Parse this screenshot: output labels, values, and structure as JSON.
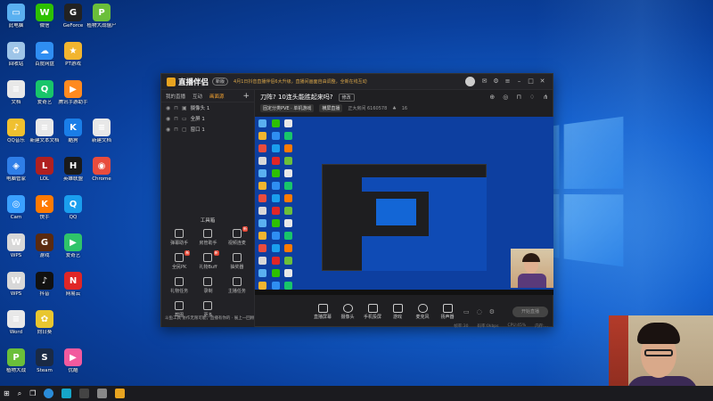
{
  "desktop": {
    "icons": [
      {
        "label": "此电脑",
        "color": "#5ab0f0",
        "glyph": "▭"
      },
      {
        "label": "微信",
        "color": "#2dc100",
        "glyph": "W"
      },
      {
        "label": "GeForce",
        "color": "#222",
        "glyph": "G"
      },
      {
        "label": "植物大战僵尸",
        "color": "#6bbf3a",
        "glyph": "P"
      },
      {
        "label": "回收站",
        "color": "#9ec5e8",
        "glyph": "♻"
      },
      {
        "label": "百度网盘",
        "color": "#2f8ef2",
        "glyph": "☁"
      },
      {
        "label": "PT游戏",
        "color": "#f2b52f",
        "glyph": "★"
      },
      {
        "label": "",
        "color": "",
        "glyph": ""
      },
      {
        "label": "文档",
        "color": "#e8e8e8",
        "glyph": "≡"
      },
      {
        "label": "爱奇艺",
        "color": "#18c56a",
        "glyph": "Q"
      },
      {
        "label": "腾讯手游助手",
        "color": "#ff8a1f",
        "glyph": "▶"
      },
      {
        "label": "",
        "color": "",
        "glyph": ""
      },
      {
        "label": "QQ音乐",
        "color": "#f0c02f",
        "glyph": "♪"
      },
      {
        "label": "新建文本文档",
        "color": "#e8e8e8",
        "glyph": "≡"
      },
      {
        "label": "酷狗",
        "color": "#1a7ee8",
        "glyph": "K"
      },
      {
        "label": "新建文档",
        "color": "#e8e8e8",
        "glyph": "≡"
      },
      {
        "label": "电脑管家",
        "color": "#2f7ee8",
        "glyph": "◈"
      },
      {
        "label": "LOL",
        "color": "#b02020",
        "glyph": "L"
      },
      {
        "label": "英雄联盟",
        "color": "#1a1a1a",
        "glyph": "H"
      },
      {
        "label": "Chrome",
        "color": "#e84c3d",
        "glyph": "◉"
      },
      {
        "label": "Cam",
        "color": "#3aa0ff",
        "glyph": "◎"
      },
      {
        "label": "快手",
        "color": "#ff7a00",
        "glyph": "K"
      },
      {
        "label": "QQ",
        "color": "#1a9eee",
        "glyph": "Q"
      },
      {
        "label": "",
        "color": "",
        "glyph": ""
      },
      {
        "label": "WPS",
        "color": "#d8d8d8",
        "glyph": "W"
      },
      {
        "label": "游戏",
        "color": "#5a2a10",
        "glyph": "G"
      },
      {
        "label": "爱奇艺",
        "color": "#2fc46a",
        "glyph": "▶"
      },
      {
        "label": "",
        "color": "",
        "glyph": ""
      },
      {
        "label": "WPS",
        "color": "#d8d8d8",
        "glyph": "W"
      },
      {
        "label": "抖音",
        "color": "#111",
        "glyph": "♪"
      },
      {
        "label": "网易云",
        "color": "#e02626",
        "glyph": "N"
      },
      {
        "label": "",
        "color": "",
        "glyph": ""
      },
      {
        "label": "Word",
        "color": "#e8e8e8",
        "glyph": "≡"
      },
      {
        "label": "向日葵",
        "color": "#e8c62f",
        "glyph": "✿"
      },
      {
        "label": "",
        "color": "",
        "glyph": ""
      },
      {
        "label": "",
        "color": "",
        "glyph": ""
      },
      {
        "label": "植物大战",
        "color": "#6bbf3a",
        "glyph": "P"
      },
      {
        "label": "Steam",
        "color": "#1a2a44",
        "glyph": "S"
      },
      {
        "label": "优酷",
        "color": "#f25a9e",
        "glyph": "▶"
      }
    ]
  },
  "app": {
    "brand": "直播伴侣",
    "version": "新版",
    "marquee": "4月1日抖音直播伴侣6大升级，直播间画面自由调整，全新在线互动",
    "left_tabs": [
      "我的直播",
      "互动",
      "画面源"
    ],
    "sources": [
      "摄像头 1",
      "全屏 1",
      "窗口 1"
    ],
    "tools_title": "工具箱",
    "tools": [
      {
        "label": "弹幕助手",
        "tag": ""
      },
      {
        "label": "房管助手",
        "tag": ""
      },
      {
        "label": "视频连麦",
        "tag": "新"
      },
      {
        "label": "全民PK",
        "tag": "新"
      },
      {
        "label": "礼物Buff",
        "tag": "新"
      },
      {
        "label": "抽奖器",
        "tag": ""
      },
      {
        "label": "礼物任务",
        "tag": ""
      },
      {
        "label": "录制",
        "tag": ""
      },
      {
        "label": "主播任务",
        "tag": ""
      },
      {
        "label": "截图",
        "tag": ""
      },
      {
        "label": "更多",
        "tag": ""
      },
      {
        "label": "",
        "tag": ""
      }
    ],
    "left_footer": "斗鱼工具  协作无限可能，直播有你的 · 展上一回顾",
    "live_title": "刀阵? 10连头能胜起来吗?",
    "edit_label": "修改",
    "chips": [
      "固定分类PVE · 单机游戏",
      "横屏直播"
    ],
    "room_info": "正大房间 6160578",
    "follow_count": "16",
    "controls": [
      "直播屏幕",
      "摄像头",
      "手机投屏",
      "游戏",
      "麦克风",
      "扬声器"
    ],
    "start_label": "开始直播",
    "status": [
      "帧率:30",
      "码率:0kbps",
      "CPU:45%",
      "内存:..."
    ]
  },
  "colors": {
    "accent": "#f0a030",
    "app_bg": "#1f1f22",
    "desktop_blue": "#1360cf"
  }
}
